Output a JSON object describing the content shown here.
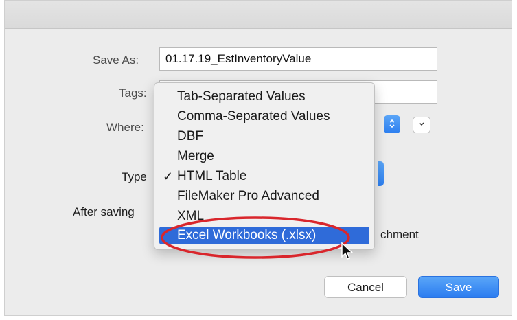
{
  "form": {
    "save_as_label": "Save As:",
    "save_as_value": "01.17.19_EstInventoryValue",
    "tags_label": "Tags:",
    "where_label": "Where:",
    "type_label": "Type",
    "after_saving_label": "After saving",
    "attachment_text_fragment": "chment"
  },
  "type_menu": {
    "items": [
      {
        "label": "Tab-Separated Values",
        "checked": false,
        "selected": false
      },
      {
        "label": "Comma-Separated Values",
        "checked": false,
        "selected": false
      },
      {
        "label": "DBF",
        "checked": false,
        "selected": false
      },
      {
        "label": "Merge",
        "checked": false,
        "selected": false
      },
      {
        "label": "HTML Table",
        "checked": true,
        "selected": false
      },
      {
        "label": "FileMaker Pro Advanced",
        "checked": false,
        "selected": false
      },
      {
        "label": "XML",
        "checked": false,
        "selected": false
      },
      {
        "label": "Excel Workbooks (.xlsx)",
        "checked": false,
        "selected": true
      }
    ],
    "check_glyph": "✓"
  },
  "buttons": {
    "cancel": "Cancel",
    "save": "Save"
  },
  "colors": {
    "accent": "#2f6bd9",
    "highlight_ellipse": "#d9262c"
  },
  "icons": {
    "where_stepper": "chevron-updown-icon",
    "expand": "chevron-down-icon",
    "cursor": "arrow-cursor-icon"
  }
}
